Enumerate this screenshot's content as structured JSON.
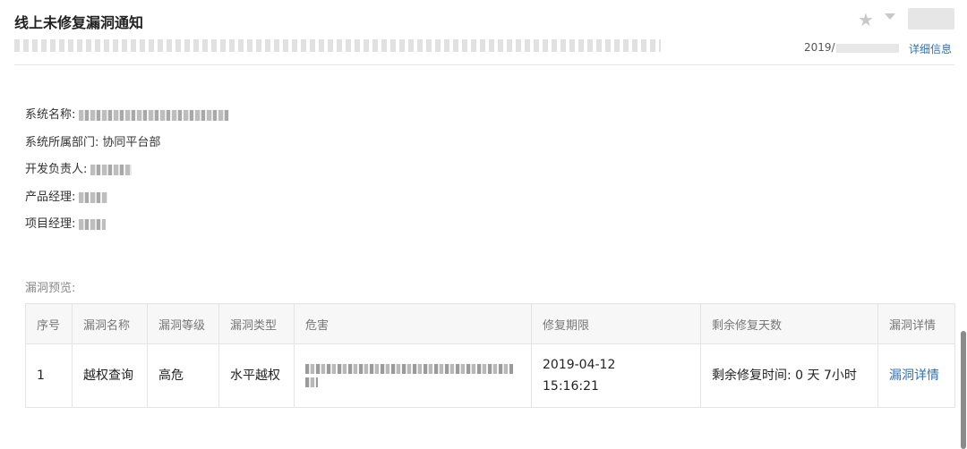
{
  "email": {
    "subject": "线上未修复漏洞通知",
    "date_prefix": "2019/",
    "details_link": "详细信息"
  },
  "info": {
    "system_name_label": "系统名称:",
    "department_label": "系统所属部门:",
    "department_value": "协同平台部",
    "dev_owner_label": "开发负责人:",
    "product_manager_label": "产品经理:",
    "project_manager_label": "项目经理:"
  },
  "preview": {
    "title": "漏洞预览:",
    "columns": [
      "序号",
      "漏洞名称",
      "漏洞等级",
      "漏洞类型",
      "危害",
      "修复期限",
      "剩余修复天数",
      "漏洞详情"
    ],
    "rows": [
      {
        "index": "1",
        "name": "越权查询",
        "level": "高危",
        "type": "水平越权",
        "deadline_date": "2019-04-12",
        "deadline_time": "15:16:21",
        "remaining": "剩余修复时间: 0 天 7小时",
        "detail_link": "漏洞详情"
      }
    ]
  },
  "icons": {
    "star": "star-icon",
    "dropdown": "chevron-down-icon"
  },
  "colors": {
    "link": "#2f6fb6",
    "header_bg": "#f7f7f7",
    "border": "#e4e4e4"
  }
}
